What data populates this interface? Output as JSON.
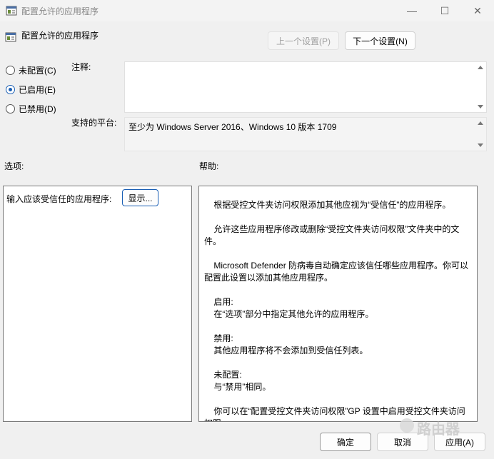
{
  "window": {
    "title": "配置允许的应用程序",
    "minimize": "—",
    "maximize": "☐",
    "close": "✕"
  },
  "header": {
    "title": "配置允许的应用程序",
    "prev_label": "上一个设置(P)",
    "next_label": "下一个设置(N)"
  },
  "state": {
    "not_configured": "未配置(C)",
    "enabled": "已启用(E)",
    "disabled": "已禁用(D)",
    "selected": "enabled"
  },
  "comment": {
    "label": "注释:",
    "value": ""
  },
  "platform": {
    "label": "支持的平台:",
    "value": "至少为 Windows Server 2016、Windows 10 版本 1709"
  },
  "options": {
    "label": "选项:",
    "field_label": "输入应该受信任的应用程序:",
    "show_button": "显示..."
  },
  "help": {
    "label": "帮助:",
    "paragraphs": [
      "    根据受控文件夹访问权限添加其他应视为“受信任”的应用程序。",
      "    允许这些应用程序修改或删除“受控文件夹访问权限”文件夹中的文件。",
      "    Microsoft Defender 防病毒自动确定应该信任哪些应用程序。你可以配置此设置以添加其他应用程序。",
      "    启用:\n    在“选项”部分中指定其他允许的应用程序。",
      "    禁用:\n    其他应用程序将不会添加到受信任列表。",
      "    未配置:\n    与“禁用”相同。",
      "    你可以在“配置受控文件夹访问权限”GP 设置中启用受控文件夹访问权限。"
    ]
  },
  "footer": {
    "ok": "确定",
    "cancel": "取消",
    "apply": "应用(A)"
  },
  "watermark": "路由器"
}
